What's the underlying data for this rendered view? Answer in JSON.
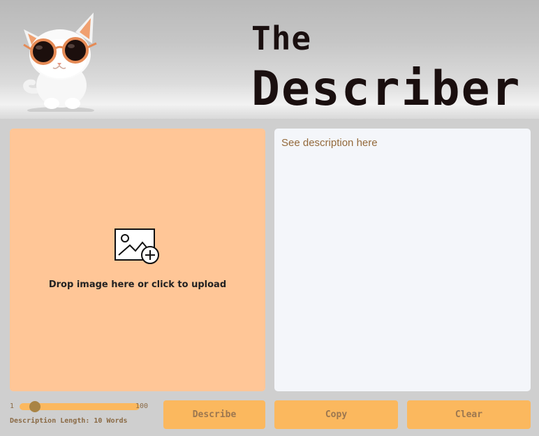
{
  "header": {
    "title_line1": "The",
    "title_line2": "Describer",
    "mascot_icon": "cat-with-sunglasses-icon"
  },
  "upload": {
    "icon": "image-add-icon",
    "text": "Drop image here or click to upload"
  },
  "output": {
    "placeholder": "See description here"
  },
  "slider": {
    "min_label": "1",
    "max_label": "100",
    "min": 1,
    "max": 100,
    "value": 10,
    "label": "Description Length: 10 Words"
  },
  "buttons": {
    "describe": "Describe",
    "copy": "Copy",
    "clear": "Clear"
  },
  "colors": {
    "upload_bg": "#ffc697",
    "button_bg": "#fbb85e",
    "button_text": "#9c7750",
    "output_bg": "#f4f6fa",
    "placeholder_text": "#946a3c"
  }
}
